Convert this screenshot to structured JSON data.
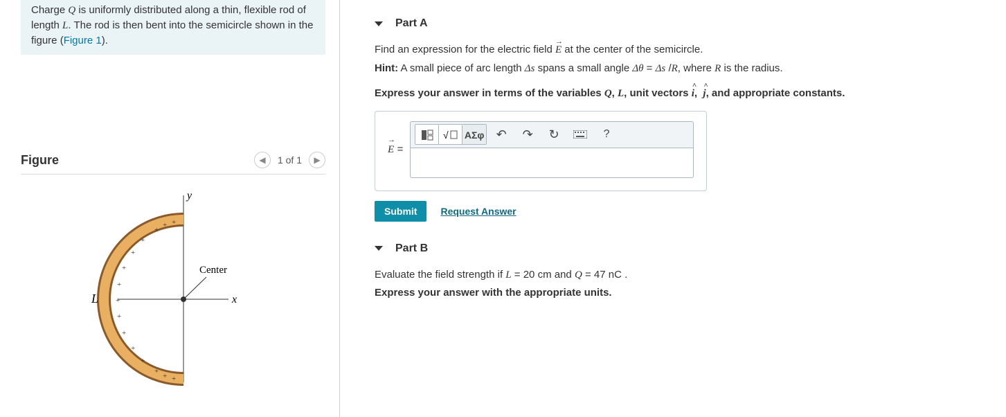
{
  "problem": {
    "text_before_link": "Charge Q is uniformly distributed along a thin, flexible rod of length L. The rod is then bent into the semicircle shown in the figure (",
    "link_text": "Figure 1",
    "text_after_link": ")."
  },
  "figure": {
    "title": "Figure",
    "nav_label": "1 of 1",
    "labels": {
      "y": "y",
      "x": "x",
      "L": "L",
      "center": "Center"
    }
  },
  "partA": {
    "title": "Part A",
    "prompt": "Find an expression for the electric field E⃗ at the center of the semicircle.",
    "hint_label": "Hint:",
    "hint_text": " A small piece of arc length Δs spans a small angle Δθ = Δs /R, where R is the radius.",
    "express_line": "Express your answer in terms of the variables Q, L, unit vectors î, ĵ, and appropriate constants.",
    "answer_label": "E⃗ =",
    "toolbar": {
      "templates": "templates-icon",
      "sqrt": "√",
      "greek": "ΑΣφ",
      "undo": "↶",
      "redo": "↷",
      "reset": "↺",
      "keyboard": "⌨",
      "help": "?"
    },
    "submit": "Submit",
    "request": "Request Answer"
  },
  "partB": {
    "title": "Part B",
    "prompt": "Evaluate the field strength if L = 20 cm and Q = 47 nC .",
    "express_line": "Express your answer with the appropriate units."
  }
}
